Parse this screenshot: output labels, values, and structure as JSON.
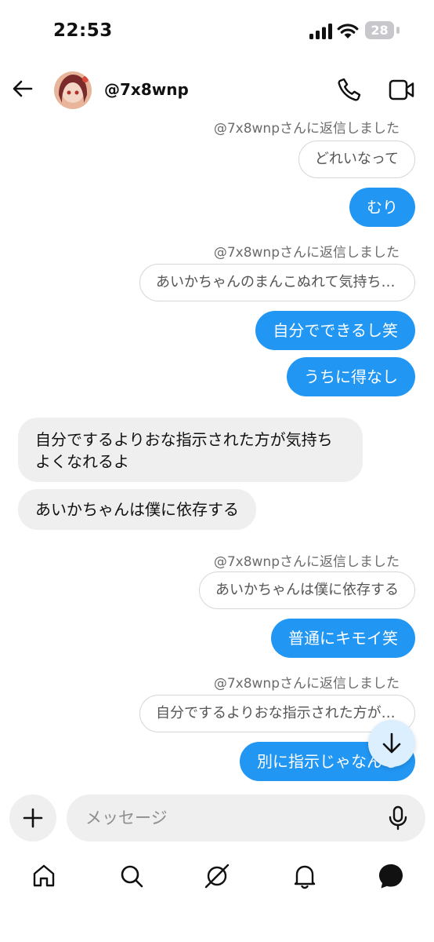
{
  "status_bar": {
    "time": "22:53",
    "battery": "28"
  },
  "header": {
    "username": "@7x8wnp"
  },
  "messages": [
    {
      "reply_label": "@7x8wnpさんに返信しました",
      "quote": "どれいなって",
      "text": "むり"
    },
    {
      "reply_label": "@7x8wnpさんに返信しました",
      "quote": "あいかちゃんのまんこぬれて気持ち…",
      "text": "自分でできるし笑"
    },
    {
      "text": "うちに得なし"
    },
    {
      "text_line1": "自分でするよりおな指示された方が気持ち",
      "text_line2": "よくなれるよ"
    },
    {
      "text": "あいかちゃんは僕に依存する"
    },
    {
      "reply_label": "@7x8wnpさんに返信しました",
      "quote": "あいかちゃんは僕に依存する",
      "text": "普通にキモイ笑"
    },
    {
      "reply_label": "@7x8wnpさんに返信しました",
      "quote": "自分でするよりおな指示された方が…",
      "text": "別に指示じゃなんも"
    }
  ],
  "composer": {
    "placeholder": "メッセージ"
  },
  "icons": {
    "accent": "#2196f3",
    "names": [
      "back-arrow-icon",
      "phone-icon",
      "video-icon",
      "arrow-down-icon",
      "plus-icon",
      "mic-icon",
      "home-icon",
      "search-icon",
      "explore-icon",
      "bell-icon",
      "messages-icon"
    ]
  }
}
